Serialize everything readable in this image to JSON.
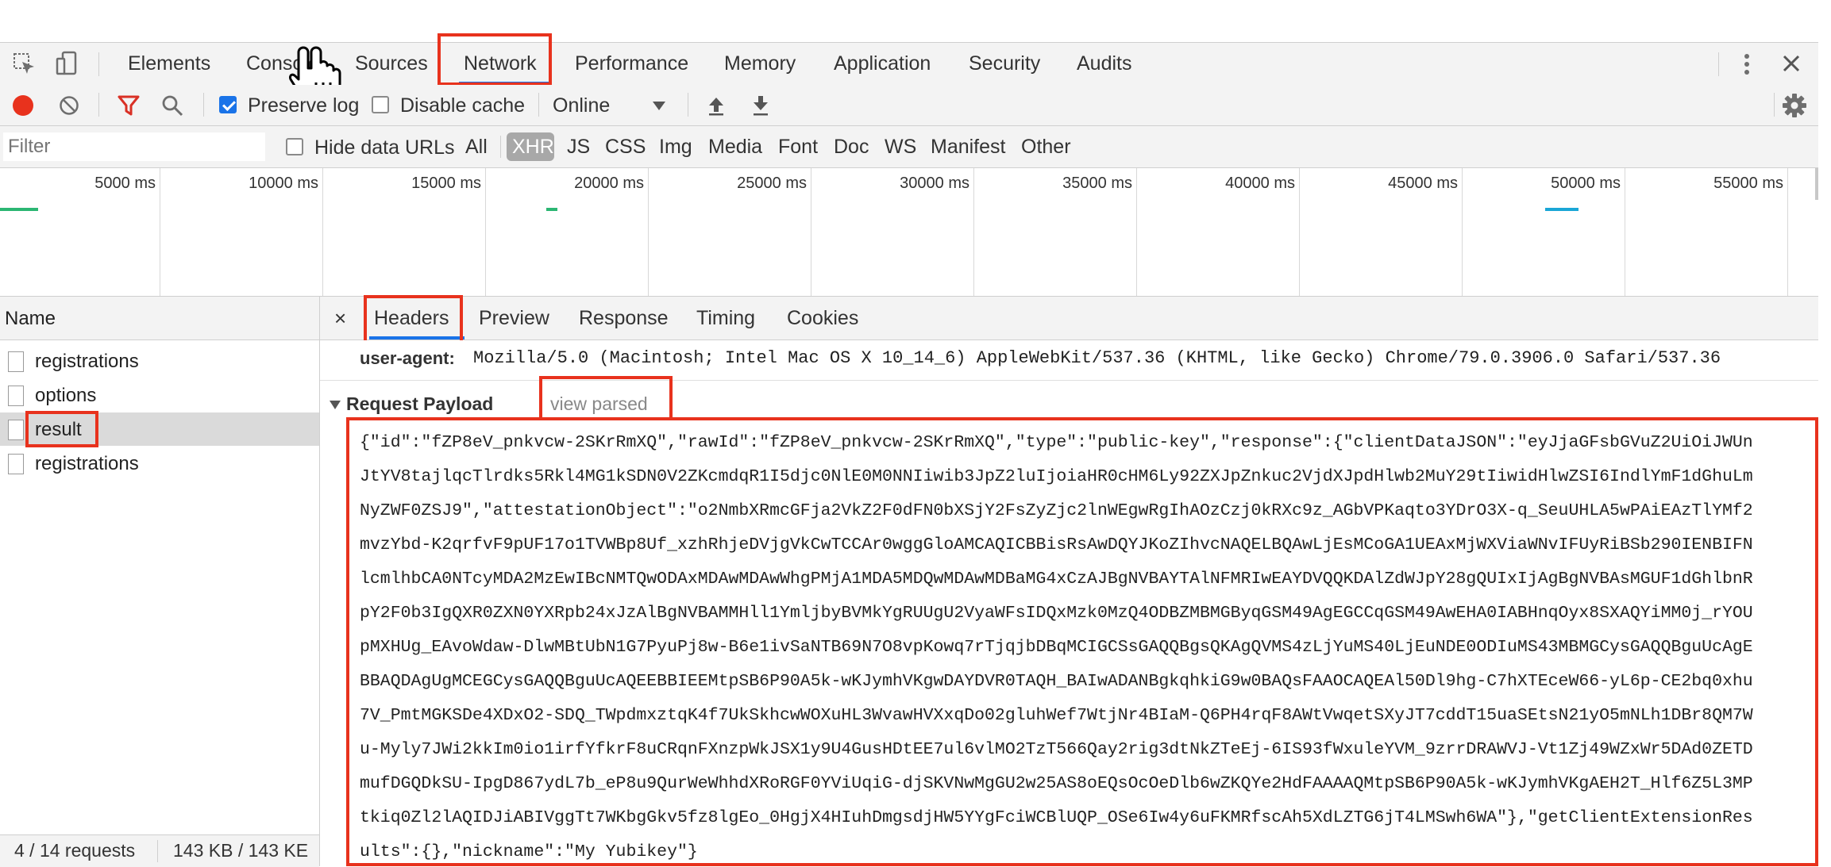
{
  "top_tabs": {
    "items": [
      "Elements",
      "Console",
      "Sources",
      "Network",
      "Performance",
      "Memory",
      "Application",
      "Security",
      "Audits"
    ],
    "active": "Network"
  },
  "toolbar": {
    "preserve_log": "Preserve log",
    "preserve_log_checked": true,
    "disable_cache": "Disable cache",
    "disable_cache_checked": false,
    "throttle": "Online",
    "record_color": "#e8321d",
    "filter_active_color": "#d93025"
  },
  "filter_bar": {
    "placeholder": "Filter",
    "hide_data_urls": "Hide data URLs",
    "types": [
      "All",
      "XHR",
      "JS",
      "CSS",
      "Img",
      "Media",
      "Font",
      "Doc",
      "WS",
      "Manifest",
      "Other"
    ],
    "selected_type": "XHR"
  },
  "overview": {
    "ticks": [
      "5000 ms",
      "10000 ms",
      "15000 ms",
      "20000 ms",
      "25000 ms",
      "30000 ms",
      "35000 ms",
      "40000 ms",
      "45000 ms",
      "50000 ms",
      "55000 ms"
    ]
  },
  "requests": {
    "header": "Name",
    "items": [
      "registrations",
      "options",
      "result",
      "registrations"
    ],
    "selected": "result"
  },
  "status_bar": {
    "requests": "4 / 14 requests",
    "size": "143 KB / 143 KE"
  },
  "detail_tabs": {
    "close": "×",
    "items": [
      "Headers",
      "Preview",
      "Response",
      "Timing",
      "Cookies"
    ],
    "active": "Headers"
  },
  "headers": {
    "user_agent_label": "user-agent:",
    "user_agent_value": "Mozilla/5.0 (Macintosh; Intel Mac OS X 10_14_6) AppleWebKit/537.36 (KHTML, like Gecko) Chrome/79.0.3906.0 Safari/537.36"
  },
  "payload": {
    "title": "Request Payload",
    "view_parsed": "view parsed",
    "lines": [
      "{\"id\":\"fZP8eV_pnkvcw-2SKrRmXQ\",\"rawId\":\"fZP8eV_pnkvcw-2SKrRmXQ\",\"type\":\"public-key\",\"response\":{\"clientDataJSON\":\"eyJjaGFsbGVuZ2UiOiJWUn",
      "JtYV8tajlqcTlrdks5Rkl4MG1kSDN0V2ZKcmdqR1I5djc0NlE0M0NNIiwib3JpZ2luIjoiaHR0cHM6Ly92ZXJpZnkuc2VjdXJpdHlwb2MuY29tIiwidHlwZSI6IndlYmF1dGhuLm",
      "NyZWF0ZSJ9\",\"attestationObject\":\"o2NmbXRmcGFja2VkZ2F0dFN0bXSjY2FsZyZjc2lnWEgwRgIhAOzCzj0kRXc9z_AGbVPKaqto3YDrO3X-q_SeuUHLA5wPAiEAzTlYMf2",
      "mvzYbd-K2qrfvF9pUF17o1TVWBp8Uf_xzhRhjeDVjgVkCwTCCAr0wggGloAMCAQICBBisRsAwDQYJKoZIhvcNAQELBQAwLjEsMCoGA1UEAxMjWXViaWNvIFUyRiBSb290IENBIFN",
      "lcmlhbCA0NTcyMDA2MzEwIBcNMTQwODAxMDAwMDAwWhgPMjA1MDA5MDQwMDAwMDBaMG4xCzAJBgNVBAYTAlNFMRIwEAYDVQQKDAlZdWJpY28gQUIxIjAgBgNVBAsMGUF1dGhlbnR",
      "pY2F0b3IgQXR0ZXN0YXRpb24xJzAlBgNVBAMMHll1YmljbyBVMkYgRUUgU2VyaWFsIDQxMzk0MzQ4ODBZMBMGByqGSM49AgEGCCqGSM49AwEHA0IABHnqOyx8SXAQYiMM0j_rYOU",
      "pMXHUg_EAvoWdaw-DlwMBtUbN1G7PyuPj8w-B6e1ivSaNTB69N7O8vpKowq7rTjqjbDBqMCIGCSsGAQQBgsQKAgQVMS4zLjYuMS40LjEuNDE0ODIuMS43MBMGCysGAQQBguUcAgE",
      "BBAQDAgUgMCEGCysGAQQBguUcAQEEBBIEEMtpSB6P90A5k-wKJymhVKgwDAYDVR0TAQH_BAIwADANBgkqhkiG9w0BAQsFAAOCAQEAl50Dl9hg-C7hXTEceW66-yL6p-CE2bq0xhu",
      "7V_PmtMGKSDe4XDxO2-SDQ_TWpdmxztqK4f7UkSkhcwWOXuHL3WvawHVXxqDo02gluhWef7WtjNr4BIaM-Q6PH4rqF8AWtVwqetSXyJT7cddT15uaSEtsN21yO5mNLh1DBr8QM7W",
      "u-Myly7JWi2kkIm0io1irfYfkrF8uCRqnFXnzpWkJSX1y9U4GusHDtEE7ul6vlMO2TzT566Qay2rig3dtNkZTeEj-6IS93fWxuleYVM_9zrrDRAWVJ-Vt1Zj49WZxWr5DAd0ZETD",
      "mufDGQDkSU-IpgD867ydL7b_eP8u9QurWeWhhdXRoRGF0YViUqiG-djSKVNwMgGU2w25AS8oEQsOcOeDlb6wZKQYe2HdFAAAAQMtpSB6P90A5k-wKJymhVKgAEH2T_Hlf6Z5L3MP",
      "tkiq0Zl2lAQIDJiABIVggTt7WKbgGkv5fz8lgEo_0HgjX4HIuhDmgsdjHW5YYgFciWCBlUQP_OSe6Iw4y6uFKMRfscAh5XdLZTG6jT4LMSwh6WA\"},\"getClientExtensionRes",
      "ults\":{},\"nickname\":\"My Yubikey\"}"
    ]
  },
  "highlight_color": "#e8321d"
}
